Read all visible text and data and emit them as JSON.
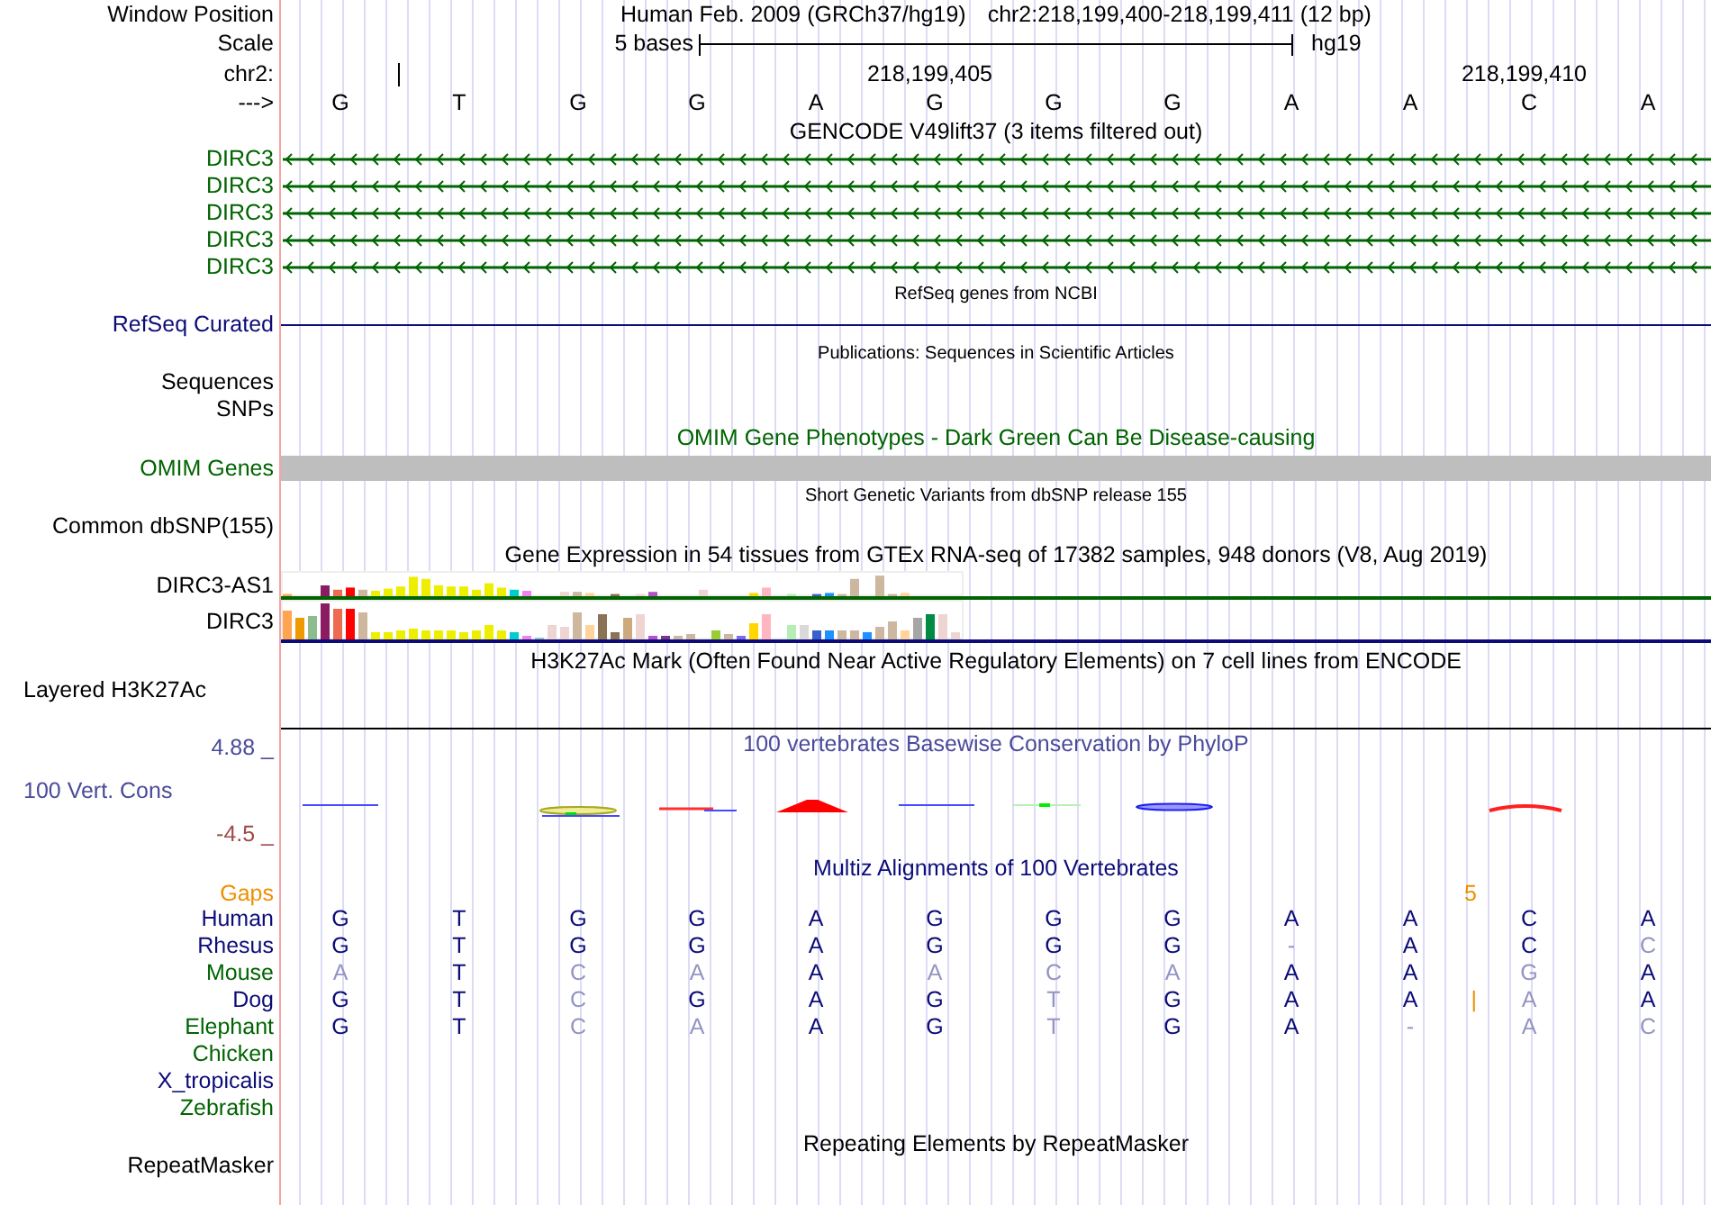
{
  "header": {
    "label": "Window Position",
    "assembly": "Human Feb. 2009 (GRCh37/hg19)",
    "position": "chr2:218,199,400-218,199,411 (12 bp)"
  },
  "scale": {
    "label": "Scale",
    "bar_label": "5 bases",
    "assembly": "hg19"
  },
  "coordinates": {
    "label": "chr2:",
    "tick_labels": [
      "218,199,405",
      "218,199,410"
    ]
  },
  "sequence": {
    "label": "--->",
    "bases": [
      "G",
      "T",
      "G",
      "G",
      "A",
      "G",
      "G",
      "G",
      "A",
      "A",
      "C",
      "A"
    ]
  },
  "gencode": {
    "title": "GENCODE V49lift37 (3 items filtered out)",
    "genes": [
      {
        "label": "DIRC3",
        "color": "#006400"
      },
      {
        "label": "DIRC3",
        "color": "#006400"
      },
      {
        "label": "DIRC3",
        "color": "#006400"
      },
      {
        "label": "DIRC3",
        "color": "#006400"
      },
      {
        "label": "DIRC3",
        "color": "#006400"
      }
    ]
  },
  "refseq": {
    "title": "RefSeq genes from NCBI",
    "label": "RefSeq Curated",
    "color": "#0c0c78"
  },
  "publications": {
    "title": "Publications: Sequences in Scientific Articles",
    "labels": [
      "Sequences",
      "SNPs"
    ]
  },
  "omim": {
    "title": "OMIM Gene Phenotypes - Dark Green Can Be Disease-causing",
    "label": "OMIM Genes",
    "color": "#006400"
  },
  "dbsnp": {
    "title": "Short Genetic Variants from dbSNP release 155",
    "label": "Common dbSNP(155)"
  },
  "gtex": {
    "title": "Gene Expression in 54 tissues from GTEx RNA-seq of 17382 samples, 948 donors (V8, Aug 2019)",
    "genes": [
      {
        "label": "DIRC3-AS1",
        "color": "#006400"
      },
      {
        "label": "DIRC3",
        "color": "#0c0c78"
      }
    ]
  },
  "h3k27ac": {
    "title": "H3K27Ac Mark (Often Found Near Active Regulatory Elements) on 7 cell lines from ENCODE",
    "label": "Layered H3K27Ac"
  },
  "conservation": {
    "title": "100 vertebrates Basewise Conservation by PhyloP",
    "label": "100 Vert. Cons",
    "max": "4.88 _",
    "min": "-4.5 _"
  },
  "multiz": {
    "title": "Multiz Alignments of 100 Vertebrates",
    "gaps": {
      "label": "Gaps",
      "count": "5"
    },
    "species": [
      {
        "label": "Human",
        "color": "#0c0c78",
        "bases": [
          "G",
          "T",
          "G",
          "G",
          "A",
          "G",
          "G",
          "G",
          "A",
          "A",
          "C",
          "A"
        ],
        "match": [
          true,
          true,
          true,
          true,
          true,
          true,
          true,
          true,
          true,
          true,
          true,
          true
        ]
      },
      {
        "label": "Rhesus",
        "color": "#0c0c78",
        "bases": [
          "G",
          "T",
          "G",
          "G",
          "A",
          "G",
          "G",
          "G",
          "-",
          "A",
          "C",
          "C"
        ],
        "match": [
          true,
          true,
          true,
          true,
          true,
          true,
          true,
          true,
          false,
          true,
          true,
          false
        ]
      },
      {
        "label": "Mouse",
        "color": "#006400",
        "bases": [
          "A",
          "T",
          "C",
          "A",
          "A",
          "A",
          "C",
          "A",
          "A",
          "A",
          "G",
          "A"
        ],
        "match": [
          false,
          true,
          false,
          false,
          true,
          false,
          false,
          false,
          true,
          true,
          false,
          true
        ]
      },
      {
        "label": "Dog",
        "color": "#0c0c78",
        "bases": [
          "G",
          "T",
          "C",
          "G",
          "A",
          "G",
          "T",
          "G",
          "A",
          "A",
          "A",
          "A"
        ],
        "match": [
          true,
          true,
          false,
          true,
          true,
          true,
          false,
          true,
          true,
          true,
          false,
          true
        ],
        "insert_mark": "|"
      },
      {
        "label": "Elephant",
        "color": "#006400",
        "bases": [
          "G",
          "T",
          "C",
          "A",
          "A",
          "G",
          "T",
          "G",
          "A",
          "-",
          "A",
          "C"
        ],
        "match": [
          true,
          true,
          false,
          false,
          true,
          true,
          false,
          true,
          true,
          false,
          false,
          false
        ]
      },
      {
        "label": "Chicken",
        "color": "#006400"
      },
      {
        "label": "X_tropicalis",
        "color": "#0c0c78"
      },
      {
        "label": "Zebrafish",
        "color": "#006400"
      }
    ]
  },
  "repeatmasker": {
    "title": "Repeating Elements by RepeatMasker",
    "label": "RepeatMasker"
  }
}
